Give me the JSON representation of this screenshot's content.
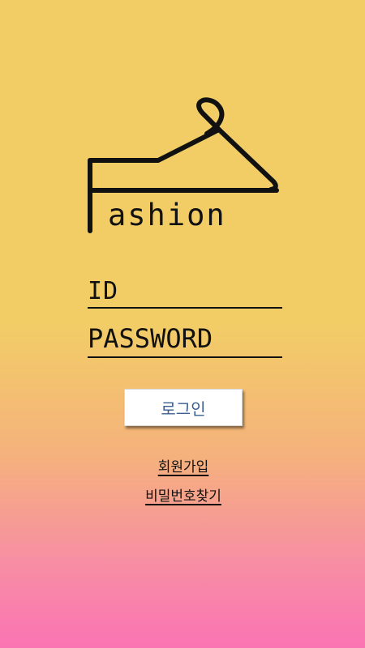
{
  "logo": {
    "icon": "hanger-icon",
    "word": "ashion",
    "ink_color": "#111111"
  },
  "form": {
    "id_label": "ID",
    "password_label": "PASSWORD"
  },
  "login_button": {
    "label": "로그인",
    "text_color": "#3b5f91"
  },
  "links": {
    "signup": "회원가입",
    "find_password": "비밀번호찾기"
  },
  "background": {
    "top_color": "#f2cd66",
    "bottom_color": "#fb74b4"
  }
}
